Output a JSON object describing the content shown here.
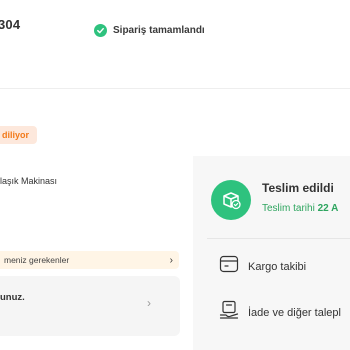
{
  "order": {
    "number_fragment": "304"
  },
  "status": {
    "label": "Sipariş tamamlandı"
  },
  "shipment": {
    "badge": "diliyor"
  },
  "product": {
    "name": "laşık Makinası"
  },
  "info_bar": {
    "text": "meniz gerekenler",
    "chevron": "›"
  },
  "rating": {
    "title": "unuz.",
    "chevron": "›"
  },
  "delivery": {
    "title": "Teslim edildi",
    "date_prefix": "Teslim tarihi",
    "date_value": "22 A"
  },
  "actions": {
    "cargo": "Kargo takibi",
    "return": "İade ve diğer talepl"
  },
  "colors": {
    "success_green": "#2ec27e",
    "date_green": "#2ea55f",
    "badge_bg": "#fde8dc",
    "badge_text": "#f27a1a",
    "info_bg": "#fff5e6",
    "panel_bg": "#f7f7f7"
  },
  "icons": {
    "status": "check-circle-icon",
    "delivered": "delivered-package-icon",
    "cargo": "cargo-truck-icon",
    "return": "return-box-icon"
  }
}
